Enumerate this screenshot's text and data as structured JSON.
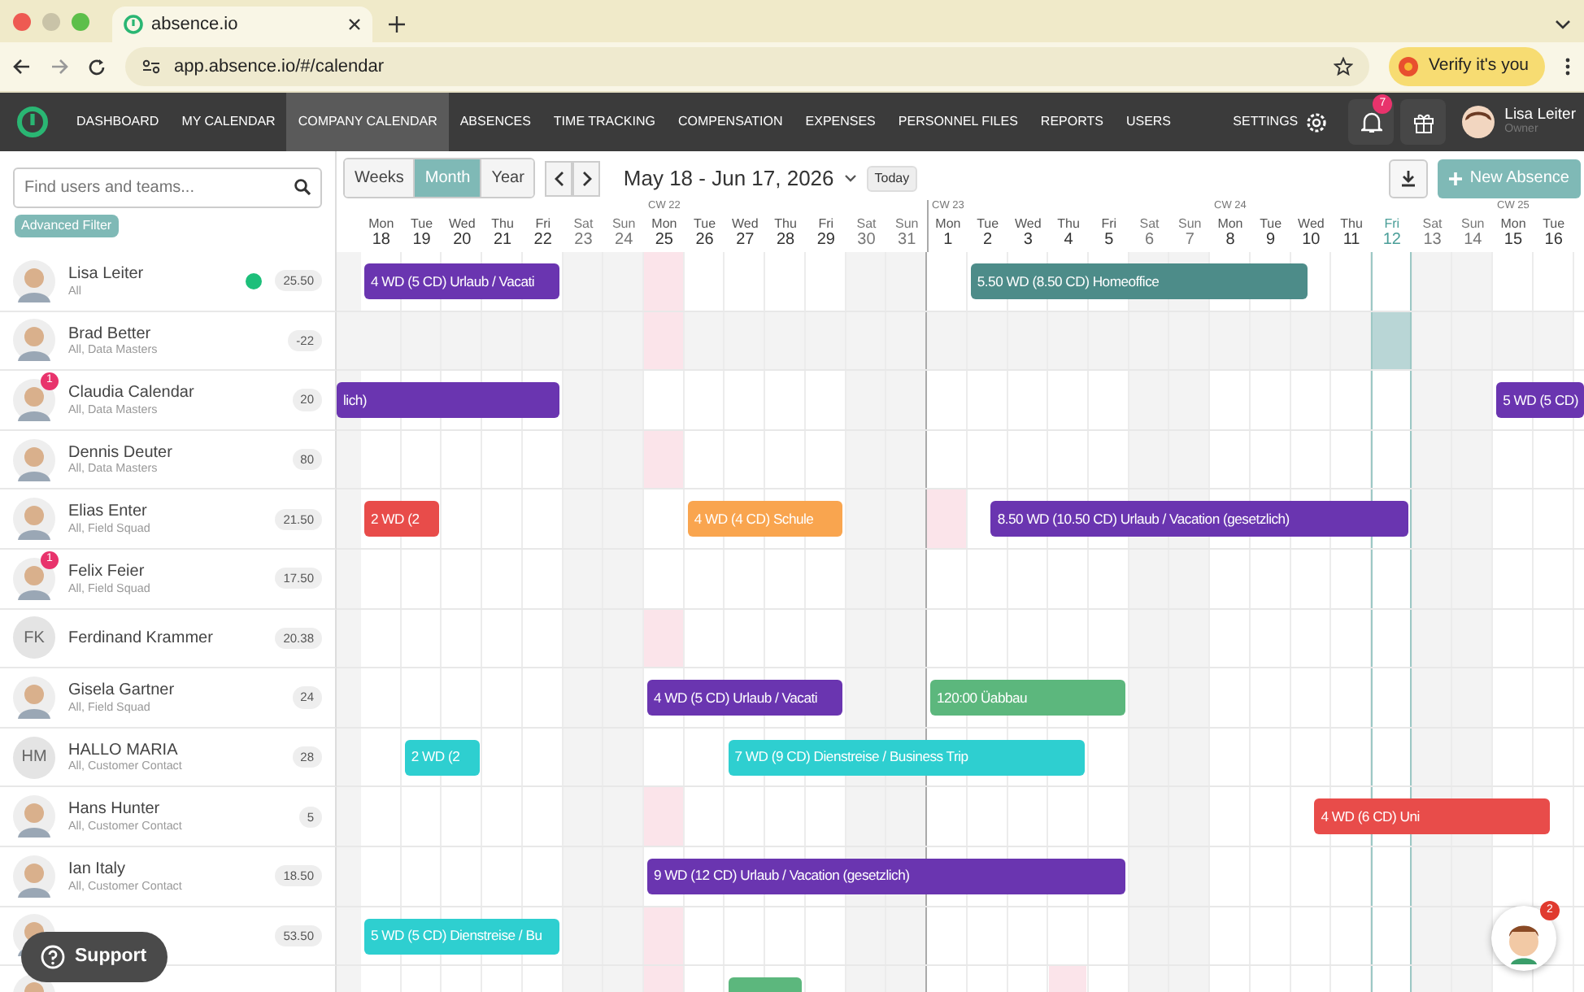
{
  "browser": {
    "tab_title": "absence.io",
    "url": "app.absence.io/#/calendar",
    "verify_label": "Verify it's you"
  },
  "nav": {
    "items": [
      {
        "label": "DASHBOARD",
        "selected": false
      },
      {
        "label": "MY CALENDAR",
        "selected": false
      },
      {
        "label": "COMPANY CALENDAR",
        "selected": true
      },
      {
        "label": "ABSENCES",
        "selected": false
      },
      {
        "label": "TIME TRACKING",
        "selected": false
      },
      {
        "label": "COMPENSATION",
        "selected": false
      },
      {
        "label": "EXPENSES",
        "selected": false
      },
      {
        "label": "PERSONNEL FILES",
        "selected": false
      },
      {
        "label": "REPORTS",
        "selected": false
      },
      {
        "label": "USERS",
        "selected": false
      }
    ],
    "settings_label": "SETTINGS",
    "notification_count": "7",
    "user": {
      "name": "Lisa Leiter",
      "role": "Owner"
    }
  },
  "toolbar": {
    "search": {
      "placeholder": "Find users and teams..."
    },
    "filter_label": "Advanced Filter",
    "views": [
      {
        "label": "Weeks",
        "selected": false
      },
      {
        "label": "Month",
        "selected": true
      },
      {
        "label": "Year",
        "selected": false
      }
    ],
    "range": "May 18 - Jun 17, 2026",
    "today_label": "Today",
    "new_label": "New Absence"
  },
  "calendar": {
    "days": [
      {
        "weekday": "Mon",
        "date": "18",
        "weekend": false,
        "today": false
      },
      {
        "weekday": "Tue",
        "date": "19",
        "weekend": false,
        "today": false
      },
      {
        "weekday": "Wed",
        "date": "20",
        "weekend": false,
        "today": false
      },
      {
        "weekday": "Thu",
        "date": "21",
        "weekend": false,
        "today": false
      },
      {
        "weekday": "Fri",
        "date": "22",
        "weekend": false,
        "today": false
      },
      {
        "weekday": "Sat",
        "date": "23",
        "weekend": true,
        "today": false
      },
      {
        "weekday": "Sun",
        "date": "24",
        "weekend": true,
        "today": false
      },
      {
        "weekday": "Mon",
        "date": "25",
        "week": "CW 22",
        "weekend": false,
        "today": false
      },
      {
        "weekday": "Tue",
        "date": "26",
        "weekend": false,
        "today": false
      },
      {
        "weekday": "Wed",
        "date": "27",
        "weekend": false,
        "today": false
      },
      {
        "weekday": "Thu",
        "date": "28",
        "weekend": false,
        "today": false
      },
      {
        "weekday": "Fri",
        "date": "29",
        "weekend": false,
        "today": false
      },
      {
        "weekday": "Sat",
        "date": "30",
        "weekend": true,
        "today": false
      },
      {
        "weekday": "Sun",
        "date": "31",
        "weekend": true,
        "today": false
      },
      {
        "weekday": "Mon",
        "date": "1",
        "week": "CW 23",
        "weekend": false,
        "today": false
      },
      {
        "weekday": "Tue",
        "date": "2",
        "weekend": false,
        "today": false
      },
      {
        "weekday": "Wed",
        "date": "3",
        "weekend": false,
        "today": false
      },
      {
        "weekday": "Thu",
        "date": "4",
        "weekend": false,
        "today": false
      },
      {
        "weekday": "Fri",
        "date": "5",
        "weekend": false,
        "today": false
      },
      {
        "weekday": "Sat",
        "date": "6",
        "weekend": true,
        "today": false
      },
      {
        "weekday": "Sun",
        "date": "7",
        "weekend": true,
        "today": false
      },
      {
        "weekday": "Mon",
        "date": "8",
        "week": "CW 24",
        "weekend": false,
        "today": false
      },
      {
        "weekday": "Tue",
        "date": "9",
        "weekend": false,
        "today": false
      },
      {
        "weekday": "Wed",
        "date": "10",
        "weekend": false,
        "today": false
      },
      {
        "weekday": "Thu",
        "date": "11",
        "weekend": false,
        "today": false
      },
      {
        "weekday": "Fri",
        "date": "12",
        "weekend": false,
        "today": true
      },
      {
        "weekday": "Sat",
        "date": "13",
        "weekend": true,
        "today": false
      },
      {
        "weekday": "Sun",
        "date": "14",
        "weekend": true,
        "today": false
      },
      {
        "weekday": "Mon",
        "date": "15",
        "week": "CW 25",
        "weekend": false,
        "today": false
      },
      {
        "weekday": "Tue",
        "date": "16",
        "weekend": false,
        "today": false
      }
    ],
    "people": [
      {
        "name": "Lisa Leiter",
        "teams": "All",
        "count": "25.50",
        "avatar": {
          "kind": "illustration"
        },
        "online": true,
        "absences": [
          {
            "label": "4 WD (5 CD) Urlaub / Vacati",
            "color": "#6a35b0"
          },
          {
            "label": "5.50 WD (8.50 CD) Homeoffice",
            "color": "#4d8c89"
          }
        ]
      },
      {
        "name": "Brad Better",
        "teams": "All, Data Masters",
        "count": "-22",
        "avatar": {
          "kind": "illustration"
        },
        "hovered": true
      },
      {
        "name": "Claudia Calendar",
        "teams": "All, Data Masters",
        "count": "20",
        "avatar": {
          "kind": "illustration"
        },
        "notifications": "1",
        "absences": [
          {
            "label": "lich)",
            "color": "#6a35b0"
          },
          {
            "label": "5 WD (5 CD)",
            "color": "#6a35b0"
          }
        ]
      },
      {
        "name": "Dennis Deuter",
        "teams": "All, Data Masters",
        "count": "80",
        "avatar": {
          "kind": "illustration"
        }
      },
      {
        "name": "Elias Enter",
        "teams": "All, Field Squad",
        "count": "21.50",
        "avatar": {
          "kind": "illustration"
        },
        "absences": [
          {
            "label": "2 WD (2",
            "color": "#e84c4a"
          },
          {
            "label": "4 WD (4 CD) Schule",
            "color": "#f9a54f"
          },
          {
            "label": "8.50 WD (10.50 CD) Urlaub / Vacation (gesetzlich)",
            "color": "#6a35b0"
          }
        ]
      },
      {
        "name": "Felix Feier",
        "teams": "All, Field Squad",
        "count": "17.50",
        "avatar": {
          "kind": "illustration"
        },
        "notifications": "1"
      },
      {
        "name": "Ferdinand Krammer",
        "count": "20.38",
        "avatar": {
          "kind": "initials",
          "initials": "FK"
        }
      },
      {
        "name": "Gisela Gartner",
        "teams": "All, Field Squad",
        "count": "24",
        "avatar": {
          "kind": "illustration"
        },
        "absences": [
          {
            "label": "4 WD (5 CD) Urlaub / Vacati",
            "color": "#6a35b0"
          },
          {
            "label": "120:00 Üabbau",
            "color": "#5cb77d"
          }
        ]
      },
      {
        "name": "HALLO MARIA",
        "teams": "All, Customer Contact",
        "count": "28",
        "avatar": {
          "kind": "initials",
          "initials": "HM"
        },
        "absences": [
          {
            "label": "2 WD (2",
            "color": "#2ecfd0"
          },
          {
            "label": "7 WD (9 CD) Dienstreise / Business Trip",
            "color": "#2ecfd0"
          }
        ]
      },
      {
        "name": "Hans Hunter",
        "teams": "All, Customer Contact",
        "count": "5",
        "avatar": {
          "kind": "illustration"
        },
        "absences": [
          {
            "label": "4 WD (6 CD) Uni",
            "color": "#e84c4a"
          }
        ]
      },
      {
        "name": "Ian Italy",
        "teams": "All, Customer Contact",
        "count": "18.50",
        "avatar": {
          "kind": "illustration"
        },
        "absences": [
          {
            "label": "9 WD (12 CD) Urlaub / Vacation (gesetzlich)",
            "color": "#6a35b0"
          }
        ]
      },
      {
        "count": "53.50",
        "avatar": {
          "kind": "illustration"
        },
        "absences": [
          {
            "label": "5 WD (5 CD) Dienstreise / Bu",
            "color": "#2ecfd0"
          }
        ]
      },
      {
        "avatar": {
          "kind": "illustration"
        },
        "absences": [
          {
            "color": "#5cb77d"
          }
        ]
      }
    ]
  },
  "support_label": "Support",
  "chat_badge": "2"
}
